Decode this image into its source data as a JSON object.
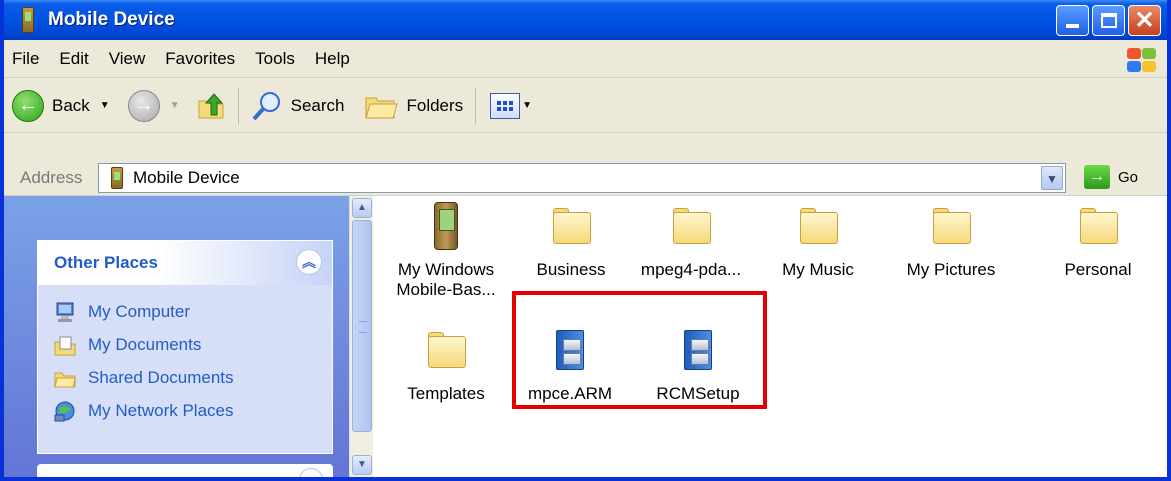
{
  "window": {
    "title": "Mobile Device",
    "controls": [
      "minimize",
      "maximize",
      "close"
    ]
  },
  "menu": [
    "File",
    "Edit",
    "View",
    "Favorites",
    "Tools",
    "Help"
  ],
  "toolbar": {
    "back_label": "Back",
    "search_label": "Search",
    "folders_label": "Folders"
  },
  "address": {
    "label": "Address",
    "value": "Mobile Device",
    "go_label": "Go"
  },
  "sidebar": {
    "other_places": {
      "title": "Other Places",
      "items": [
        "My Computer",
        "My Documents",
        "Shared Documents",
        "My Network Places"
      ]
    }
  },
  "files": [
    {
      "name": "My Windows Mobile-Bas...",
      "line1": "My Windows",
      "line2": "Mobile-Bas...",
      "icon": "pda-icon"
    },
    {
      "name": "Business",
      "icon": "folder-icon"
    },
    {
      "name": "mpeg4-pda...",
      "icon": "folder-icon"
    },
    {
      "name": "My Music",
      "icon": "folder-icon"
    },
    {
      "name": "My Pictures",
      "icon": "folder-icon"
    },
    {
      "name": "Personal",
      "icon": "folder-icon"
    },
    {
      "name": "Templates",
      "icon": "folder-icon"
    },
    {
      "name": "mpce.ARM",
      "icon": "cabinet-file-icon"
    },
    {
      "name": "RCMSetup",
      "icon": "cabinet-file-icon"
    }
  ],
  "colors": {
    "highlight_box": "#e50000",
    "title_bar": "#0054e3",
    "sidebar_bg": "#7ba2e7",
    "link_text": "#215dc6"
  }
}
